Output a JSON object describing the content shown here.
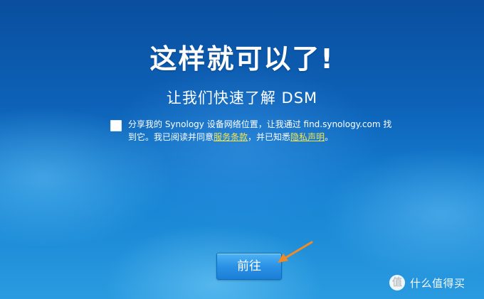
{
  "setup": {
    "title": "这样就可以了!",
    "subtitle": "让我们快速了解 DSM",
    "agree": {
      "text_1": "分享我的 Synology 设备网络位置，让我通过 find.synology.com 找到它。我已阅读并同意",
      "terms_link": "服务条款",
      "text_2": "，并已知悉",
      "privacy_link": "隐私声明",
      "text_3": "。",
      "checked": false,
      "link_color": "#f4e64e"
    },
    "go_button": "前往",
    "accent_color": "#2a91e6"
  },
  "annotation": {
    "arrow_color": "#f08a24"
  },
  "watermark": {
    "logo_glyph": "值",
    "text": "什么值得买"
  }
}
